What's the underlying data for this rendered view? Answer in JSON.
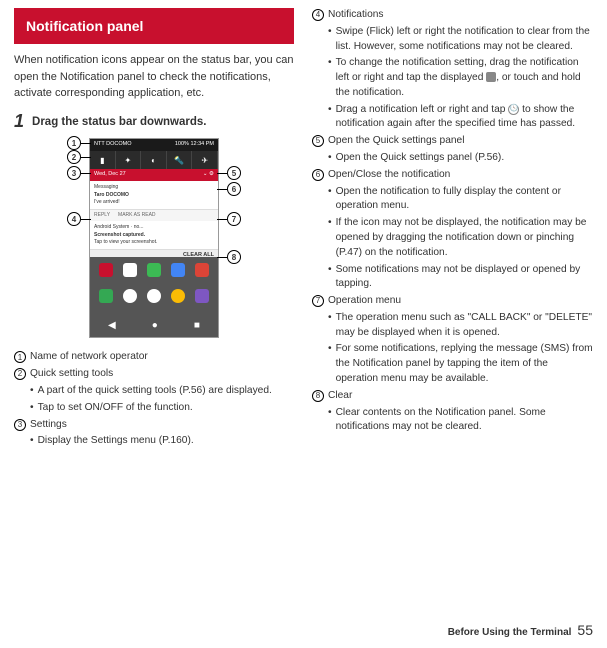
{
  "heading": "Notification panel",
  "intro": "When notification icons appear on the status bar, you can open the Notification panel to check the notifications, activate corresponding application, etc.",
  "step": {
    "num": "1",
    "text": "Drag the status bar downwards."
  },
  "screenshot": {
    "carrier": "NTT DOCOMO",
    "battery": "100%",
    "time": "12:34 PM",
    "date": "Wed, Dec 27",
    "notif1_app": "Messaging",
    "notif1_title": "Taro DOCOMO",
    "notif1_body": "I've arrived!",
    "action_reply": "REPLY",
    "action_mark": "MARK AS READ",
    "notif2_app": "Android System · no...",
    "notif2_title": "Screenshot captured.",
    "notif2_body": "Tap to view your screenshot.",
    "clear": "CLEAR ALL"
  },
  "left_items": {
    "i1": {
      "label": "Name of network operator"
    },
    "i2": {
      "label": "Quick setting tools",
      "b1": "A part of the quick setting tools (P.56) are displayed.",
      "b2": "Tap to set ON/OFF of the function."
    },
    "i3": {
      "label": "Settings",
      "b1": "Display the Settings menu (P.160)."
    }
  },
  "right_items": {
    "i4": {
      "label": "Notifications",
      "b1": "Swipe (Flick) left or right the notification to clear from the list. However, some notifications may not be cleared.",
      "b2a": "To change the notification setting, drag the notification left or right and tap the displayed ",
      "b2b": ", or touch and hold the notification.",
      "b3a": "Drag a notification left or right and tap ",
      "b3b": " to show the notification again after the specified time has passed."
    },
    "i5": {
      "label": "Open the Quick settings panel",
      "b1": "Open the Quick settings panel (P.56)."
    },
    "i6": {
      "label": "Open/Close the notification",
      "b1": "Open the notification to fully display the content or operation menu.",
      "b2": "If the icon may not be displayed, the notification may be opened by dragging the notification down or pinching (P.47) on the notification.",
      "b3": "Some notifications may not be displayed or opened by tapping."
    },
    "i7": {
      "label": "Operation menu",
      "b1": "The operation menu such as \"CALL BACK\" or \"DELETE\" may be displayed when it is opened.",
      "b2": "For some notifications, replying the message (SMS) from the Notification panel by tapping the item of the operation menu may be available."
    },
    "i8": {
      "label": "Clear",
      "b1": "Clear contents on the Notification panel. Some notifications may not be cleared."
    }
  },
  "footer": {
    "section": "Before Using the Terminal",
    "page": "55"
  }
}
